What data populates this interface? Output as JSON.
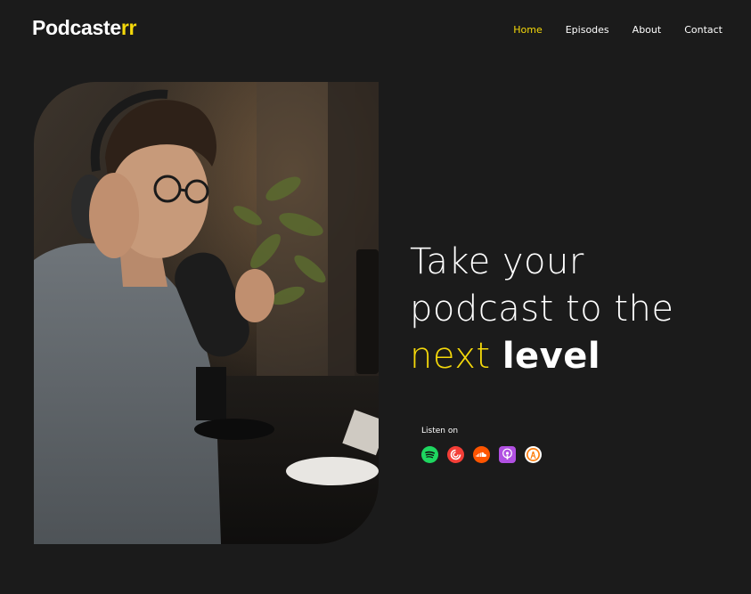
{
  "brand": {
    "name_main": "Podcaste",
    "name_accent": "rr",
    "accent_color": "#f5d90a"
  },
  "nav": {
    "items": [
      {
        "label": "Home",
        "active": true
      },
      {
        "label": "Episodes",
        "active": false
      },
      {
        "label": "About",
        "active": false
      },
      {
        "label": "Contact",
        "active": false
      }
    ]
  },
  "hero": {
    "line1": "Take your",
    "line2": "podcast to the",
    "line3_accent": "next",
    "line3_bold": "level",
    "image_alt": "podcaster-with-microphone-photo"
  },
  "listen": {
    "label": "Listen on",
    "platforms": [
      {
        "icon": "spotify-icon",
        "color": "#1ed760"
      },
      {
        "icon": "pocket-casts-icon",
        "color": "#f43e37"
      },
      {
        "icon": "soundcloud-icon",
        "color": "#ff5500"
      },
      {
        "icon": "apple-podcasts-icon",
        "color": "#b150e2"
      },
      {
        "icon": "overcast-icon",
        "color": "#fc7e0f"
      }
    ]
  },
  "colors": {
    "background": "#1b1b1b",
    "text": "#ffffff",
    "accent": "#f5d90a"
  }
}
